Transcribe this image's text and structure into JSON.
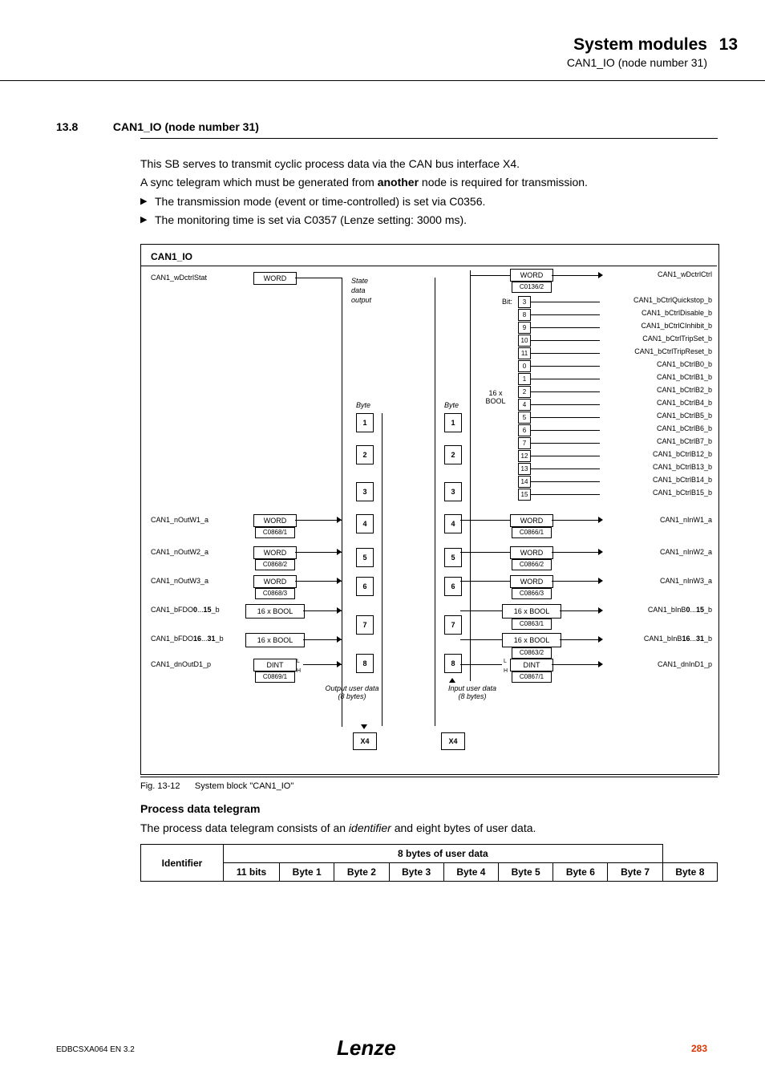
{
  "header": {
    "title": "System modules",
    "subtitle": "CAN1_IO (node number 31)",
    "chapnum": "13"
  },
  "section": {
    "num": "13.8",
    "title": "CAN1_IO (node number 31)"
  },
  "para1": "This SB serves to transmit cyclic process data via the CAN bus interface X4.",
  "para2_a": "A sync telegram which must be generated from ",
  "para2_b": "another",
  "para2_c": " node is required for transmission.",
  "bul1": "The transmission mode (event or time-controlled) is set via C0356.",
  "bul2": "The monitoring time is set via C0357 (Lenze setting: 3000 ms).",
  "diag": {
    "title": "CAN1_IO",
    "state": "State",
    "data": "data",
    "output": "output",
    "byte": "Byte",
    "word": "WORD",
    "dint": "DINT",
    "bool16": "16 x BOOL",
    "bitlbl": "Bit:",
    "xBOOL": "16 x\nBOOL",
    "x4": "X4",
    "outUser": "Output user data\n(8 bytes)",
    "inUser": "Input user data\n(8 bytes)",
    "left": {
      "ctrlstat": "CAN1_wDctrlStat",
      "outw1": "CAN1_nOutW1_a",
      "outw2": "CAN1_nOutW2_a",
      "outw3": "CAN1_nOutW3_a",
      "fdo0": "CAN1_bFDO0...15_b",
      "fdo16": "CAN1_bFDO16...31_b",
      "dout": "CAN1_dnOutD1_p",
      "c0868_1": "C0868/1",
      "c0868_2": "C0868/2",
      "c0868_3": "C0868/3",
      "c0869_1": "C0869/1"
    },
    "right": {
      "ctrlctrl": "CAN1_wDctrlCtrl",
      "c0136_2": "C0136/2",
      "quick": "CAN1_bCtrlQuickstop_b",
      "disable": "CAN1_bCtrlDisable_b",
      "cinhibit": "CAN1_bCtrlCInhibit_b",
      "tripset": "CAN1_bCtrlTripSet_b",
      "tripreset": "CAN1_bCtrlTripReset_b",
      "b0": "CAN1_bCtrlB0_b",
      "b1": "CAN1_bCtrlB1_b",
      "b2": "CAN1_bCtrlB2_b",
      "b4": "CAN1_bCtrlB4_b",
      "b5": "CAN1_bCtrlB5_b",
      "b6": "CAN1_bCtrlB6_b",
      "b7": "CAN1_bCtrlB7_b",
      "b12": "CAN1_bCtrlB12_b",
      "b13": "CAN1_bCtrlB13_b",
      "b14": "CAN1_bCtrlB14_b",
      "b15": "CAN1_bCtrlB15_b",
      "inw1": "CAN1_nInW1_a",
      "inw2": "CAN1_nInW2_a",
      "inw3": "CAN1_nInW3_a",
      "binb0": "CAN1_bInB0...15_b",
      "binb16": "CAN1_bInB16...31_b",
      "dind": "CAN1_dnInD1_p",
      "c0866_1": "C0866/1",
      "c0866_2": "C0866/2",
      "c0866_3": "C0866/3",
      "c0863_1": "C0863/1",
      "c0863_2": "C0863/2",
      "c0867_1": "C0867/1"
    },
    "bits": [
      "3",
      "8",
      "9",
      "10",
      "11",
      "0",
      "1",
      "2",
      "4",
      "5",
      "6",
      "7",
      "12",
      "13",
      "14",
      "15"
    ],
    "bytes": [
      "1",
      "2",
      "3",
      "4",
      "5",
      "6",
      "7",
      "8"
    ]
  },
  "fig_caption_a": "Fig. 13-12",
  "fig_caption_b": "System block \"CAN1_IO\"",
  "subhead": "Process data telegram",
  "para3_a": "The process data telegram consists of an ",
  "para3_b": "identifier",
  "para3_c": " and eight bytes of user data.",
  "table": {
    "h1": "Identifier",
    "h2": "8 bytes of user data",
    "r1": "11 bits",
    "b": [
      "Byte 1",
      "Byte 2",
      "Byte 3",
      "Byte 4",
      "Byte 5",
      "Byte 6",
      "Byte 7",
      "Byte 8"
    ]
  },
  "footer": {
    "left": "EDBCSXA064 EN 3.2",
    "logo": "Lenze",
    "page": "283"
  }
}
